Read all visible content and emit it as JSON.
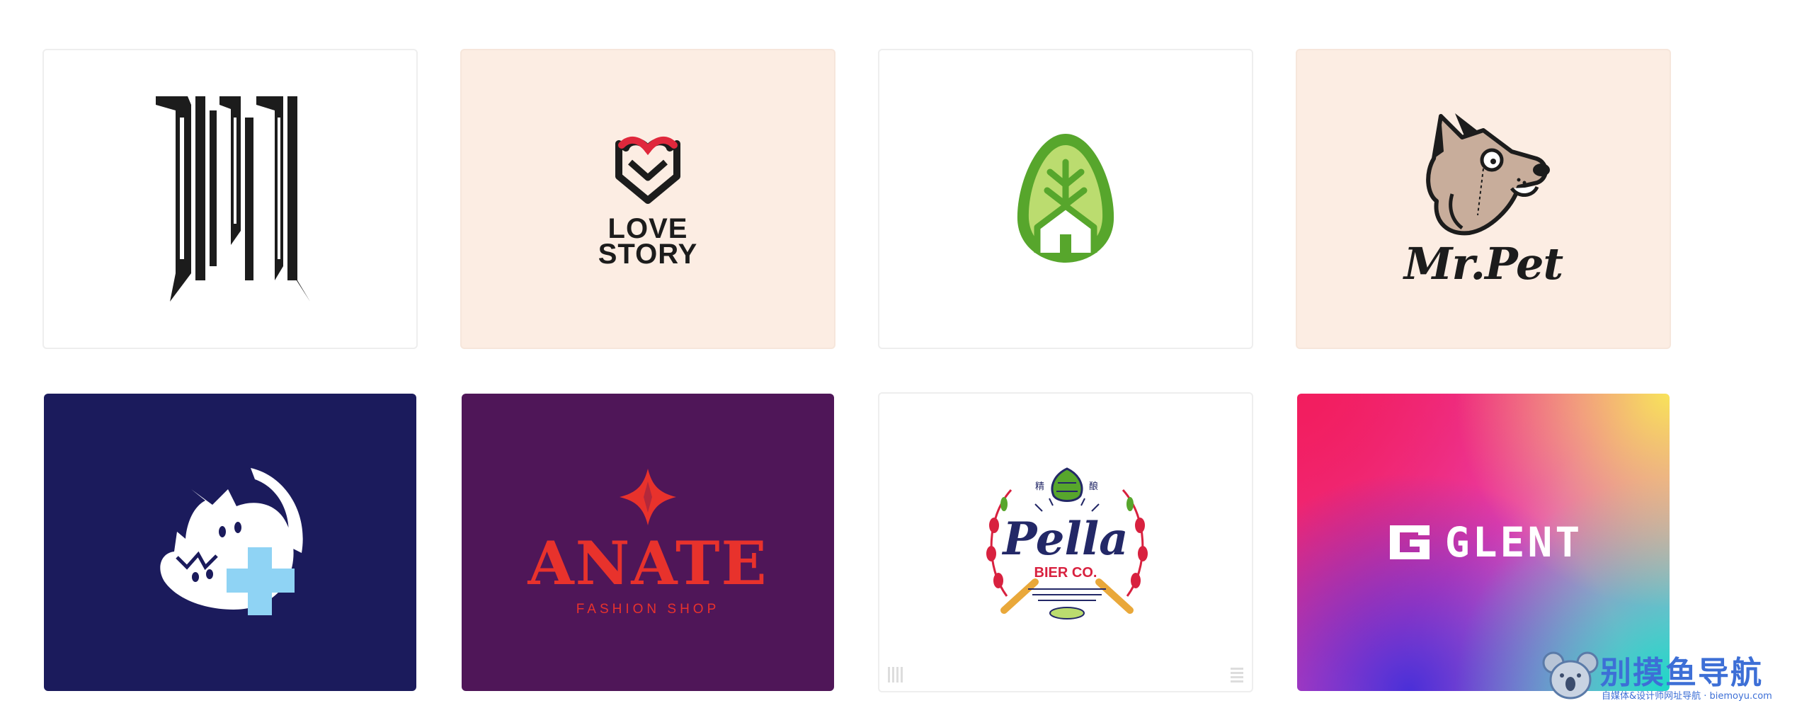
{
  "colors": {
    "page_bg": "#ffffff",
    "card_white": "#ffffff",
    "card_peach": "#fcede3",
    "card_navy": "#1b1b5c",
    "card_purple": "#4f1658",
    "ink": "#1c1c1c",
    "heart_red": "#e0283c",
    "leaf_green": "#57a62c",
    "leaf_light": "#bbdc6f",
    "anate_red": "#e8322c",
    "pet_cross": "#8fd3f4",
    "pella_navy": "#232867",
    "pella_red": "#d8213f"
  },
  "cards": [
    {
      "name": "Dyson",
      "bg": "peach_no",
      "icon": "dyson-lettering-icon"
    },
    {
      "name": "Love Story",
      "line1": "LOVE",
      "line2": "STORY",
      "icon": "heart-envelope-icon"
    },
    {
      "name": "Tree House",
      "icon": "tree-house-leaf-icon"
    },
    {
      "name": "Mr.Pet",
      "wordmark": "Mr.Pet",
      "icon": "dog-monocle-icon"
    },
    {
      "name": "Pet Care",
      "icon": "pets-cross-icon"
    },
    {
      "name": "Anate",
      "wordmark": "ANATE",
      "tagline": "FASHION SHOP",
      "icon": "diamond-star-icon"
    },
    {
      "name": "Pella",
      "wordmark": "Pella",
      "tagline": "BIER CO.",
      "cn_left": "精",
      "cn_right": "酿",
      "icon": "hop-wreath-icon"
    },
    {
      "name": "Glent",
      "wordmark": "GLENT",
      "icon": "glent-g-icon"
    }
  ],
  "watermark": {
    "title": "别摸鱼导航",
    "subtitle": "自媒体&设计师网址导航 · biemoyu.com",
    "icon": "koala-icon"
  }
}
